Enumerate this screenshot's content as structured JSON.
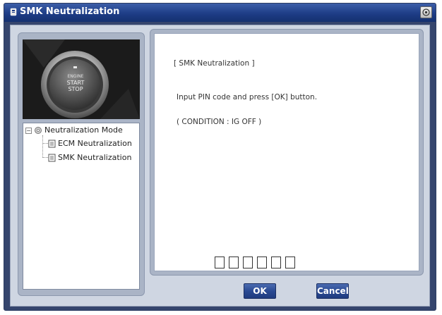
{
  "window": {
    "title": "SMK Neutralization"
  },
  "tree": {
    "root_label": "Neutralization Mode",
    "items": [
      {
        "label": "ECM Neutralization"
      },
      {
        "label": "SMK Neutralization"
      }
    ]
  },
  "photo": {
    "button_text_line1": "ENGINE",
    "button_text_line2": "START",
    "button_text_line3": "STOP"
  },
  "content": {
    "heading": "[ SMK Neutralization ]",
    "instruction": "Input PIN code and press [OK] button.",
    "condition": "( CONDITION : IG OFF )",
    "pin_boxes": [
      "",
      "",
      "",
      "",
      "",
      ""
    ]
  },
  "buttons": {
    "ok_label": "OK",
    "cancel_label": "Cancel"
  },
  "colors": {
    "title_bar": "#1e3d86",
    "client_bg": "#cfd6e2",
    "panel_bg": "#aab4c6",
    "button_bg": "#2a4a93"
  }
}
